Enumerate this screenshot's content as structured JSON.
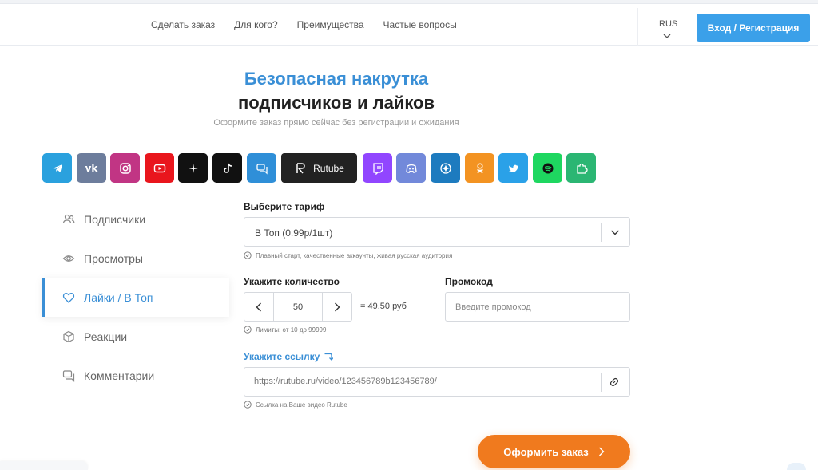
{
  "nav": {
    "items": [
      "Сделать заказ",
      "Для кого?",
      "Преимущества",
      "Частые вопросы"
    ],
    "lang": "RUS",
    "login_label": "Вход / Регистрация"
  },
  "hero": {
    "title_line1": "Безопасная накрутка",
    "title_line2": "подписчиков и лайков",
    "subtitle": "Оформите заказ прямо сейчас без регистрации и ожидания"
  },
  "platforms": [
    {
      "icon": "telegram-icon",
      "color": "#2aa1de"
    },
    {
      "icon": "vk-icon",
      "color": "#6d7d9c",
      "glyph": "vk"
    },
    {
      "icon": "instagram-icon",
      "color": "#c13584"
    },
    {
      "icon": "youtube-icon",
      "color": "#e9161d"
    },
    {
      "icon": "sparkle-icon",
      "color": "#111111"
    },
    {
      "icon": "tiktok-icon",
      "color": "#111111"
    },
    {
      "icon": "chat-icon",
      "color": "#2f8fd8"
    },
    {
      "icon": "rutube-icon",
      "color": "#222222",
      "label": "Rutube"
    },
    {
      "icon": "twitch-icon",
      "color": "#9146ff"
    },
    {
      "icon": "discord-icon",
      "color": "#7289da"
    },
    {
      "icon": "dzen-icon",
      "color": "#1d7bbf"
    },
    {
      "icon": "odnoklassniki-icon",
      "color": "#f39322"
    },
    {
      "icon": "twitter-icon",
      "color": "#2aa1e8"
    },
    {
      "icon": "spotify-icon",
      "color": "#1ed760"
    },
    {
      "icon": "puzzle-icon",
      "color": "#2bb673"
    }
  ],
  "sidebar": {
    "items": [
      {
        "label": "Подписчики",
        "icon": "users-icon"
      },
      {
        "label": "Просмотры",
        "icon": "eye-icon"
      },
      {
        "label": "Лайки / В Топ",
        "icon": "heart-icon"
      },
      {
        "label": "Реакции",
        "icon": "cube-icon"
      },
      {
        "label": "Комментарии",
        "icon": "comments-icon"
      }
    ]
  },
  "form": {
    "tariff_label": "Выберите тариф",
    "tariff_value": "В Топ (0.99р/1шт)",
    "tariff_hint": "Плавный старт, качественные аккаунты, живая русская аудитория",
    "qty_label": "Укажите количество",
    "qty_value": "50",
    "price": "= 49.50 руб",
    "qty_hint": "Лимиты: от 10 до 99999",
    "promo_label": "Промокод",
    "promo_placeholder": "Введите промокод",
    "link_label": "Укажите ссылку",
    "link_value": "https://rutube.ru/video/123456789b123456789/",
    "link_hint": "Ссылка на Ваше видео Rutube",
    "submit_label": "Оформить заказ"
  }
}
